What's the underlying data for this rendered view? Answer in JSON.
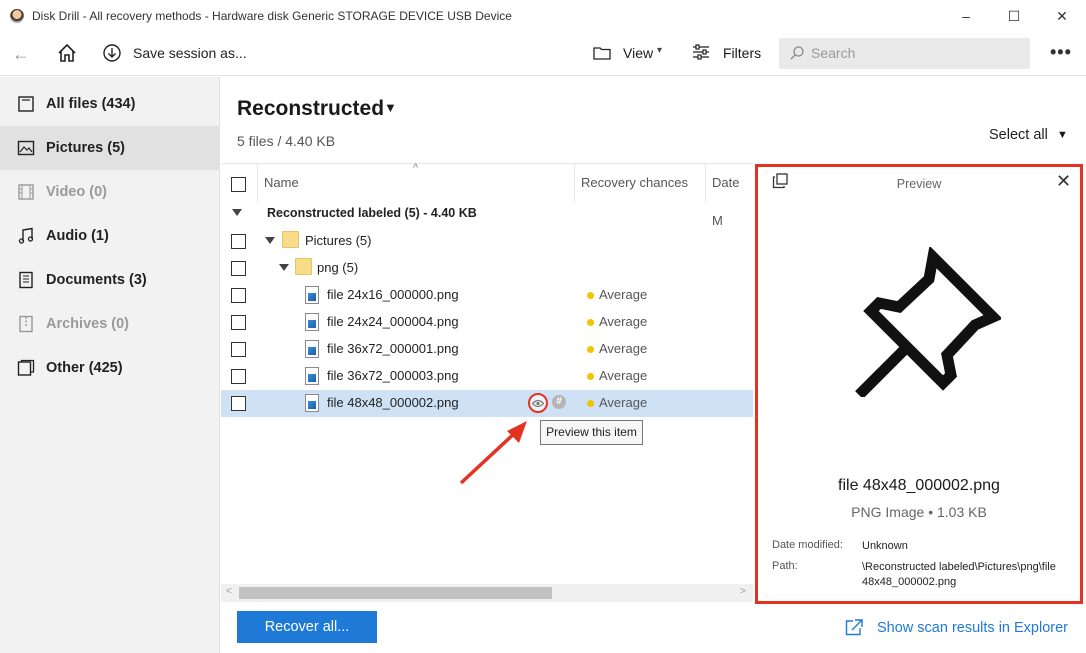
{
  "window": {
    "title": "Disk Drill - All recovery methods - Hardware disk Generic STORAGE DEVICE USB Device",
    "minimize": "–",
    "maximize": "☐",
    "close": "✕"
  },
  "toolbar": {
    "back": "←",
    "save_label": "Save session as...",
    "view_label": "View",
    "filters_label": "Filters",
    "search_placeholder": "Search",
    "more": "•••"
  },
  "sidebar": {
    "items": [
      {
        "label": "All files (434)",
        "icon": "all-files-icon",
        "active": false,
        "disabled": false
      },
      {
        "label": "Pictures (5)",
        "icon": "pictures-icon",
        "active": true,
        "disabled": false
      },
      {
        "label": "Video (0)",
        "icon": "video-icon",
        "active": false,
        "disabled": true
      },
      {
        "label": "Audio (1)",
        "icon": "audio-icon",
        "active": false,
        "disabled": false
      },
      {
        "label": "Documents (3)",
        "icon": "documents-icon",
        "active": false,
        "disabled": false
      },
      {
        "label": "Archives (0)",
        "icon": "archives-icon",
        "active": false,
        "disabled": true
      },
      {
        "label": "Other (425)",
        "icon": "other-icon",
        "active": false,
        "disabled": false
      }
    ]
  },
  "main": {
    "title": "Reconstructed",
    "subtitle": "5 files / 4.40 KB",
    "select_all": "Select all",
    "columns": {
      "name": "Name",
      "recovery": "Recovery chances",
      "date": "Date M"
    },
    "group": "Reconstructed labeled (5) - 4.40 KB",
    "folders": [
      "Pictures (5)",
      "png (5)"
    ],
    "files": [
      {
        "name": "file 24x16_000000.png",
        "chance": "Average"
      },
      {
        "name": "file 24x24_000004.png",
        "chance": "Average"
      },
      {
        "name": "file 36x72_000001.png",
        "chance": "Average"
      },
      {
        "name": "file 36x72_000003.png",
        "chance": "Average"
      },
      {
        "name": "file 48x48_000002.png",
        "chance": "Average"
      }
    ],
    "hash_glyph": "#",
    "tooltip": "Preview this item",
    "recover_button": "Recover all...",
    "explorer_link": "Show scan results in Explorer"
  },
  "preview": {
    "title": "Preview",
    "file_name": "file 48x48_000002.png",
    "file_type": "PNG Image • 1.03 KB",
    "date_label": "Date modified:",
    "date_value": "Unknown",
    "path_label": "Path:",
    "path_value": "\\Reconstructed labeled\\Pictures\\png\\file 48x48_000002.png"
  },
  "colors": {
    "accent": "#1e7ad6",
    "highlight": "#e53322",
    "selected_row": "#cfe2f5",
    "chance_dot": "#f3c300"
  }
}
